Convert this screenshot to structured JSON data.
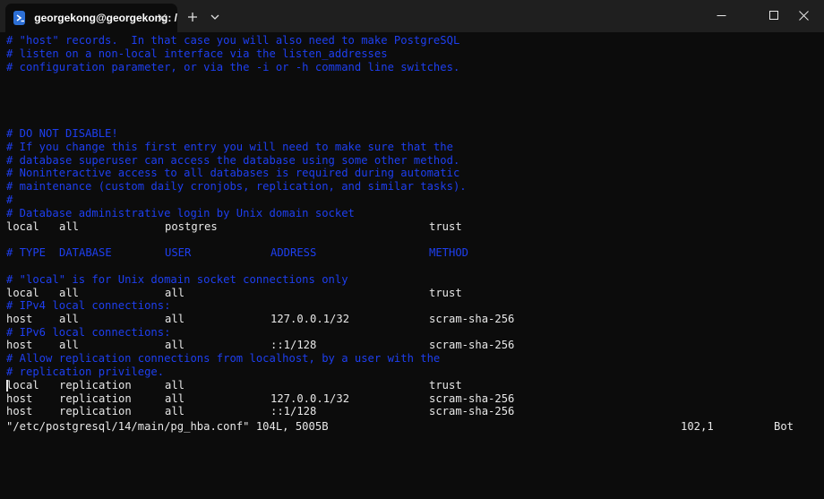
{
  "window": {
    "tab_title": "georgekong@georgekong: /",
    "tab_icon": "powershell-icon",
    "new_tab_icon": "plus-icon",
    "dropdown_icon": "chevron-down-icon",
    "minimize_icon": "minimize-icon",
    "maximize_icon": "maximize-icon",
    "close_icon": "close-icon"
  },
  "colors": {
    "background": "#0c0c0c",
    "titlebar": "#1f1f1f",
    "comment": "#1e3ff0",
    "text": "#e8e8e8"
  },
  "comments": {
    "c1": "# \"host\" records.  In that case you will also need to make PostgreSQL",
    "c2": "# listen on a non-local interface via the listen_addresses",
    "c3": "# configuration parameter, or via the -i or -h command line switches.",
    "c4": "# DO NOT DISABLE!",
    "c5": "# If you change this first entry you will need to make sure that the",
    "c6": "# database superuser can access the database using some other method.",
    "c7": "# Noninteractive access to all databases is required during automatic",
    "c8": "# maintenance (custom daily cronjobs, replication, and similar tasks).",
    "c9": "#",
    "c10": "# Database administrative login by Unix domain socket",
    "c11": "# \"local\" is for Unix domain socket connections only",
    "c12": "# IPv4 local connections:",
    "c13": "# IPv6 local connections:",
    "c14": "# Allow replication connections from localhost, by a user with the",
    "c15": "# replication privilege."
  },
  "header_row": {
    "type": "# TYPE",
    "database": "DATABASE",
    "user": "USER",
    "address": "ADDRESS",
    "method": "METHOD"
  },
  "rows": [
    {
      "type": "local",
      "database": "all",
      "user": "postgres",
      "address": "",
      "method": "trust"
    },
    {
      "type": "local",
      "database": "all",
      "user": "all",
      "address": "",
      "method": "trust"
    },
    {
      "type": "host",
      "database": "all",
      "user": "all",
      "address": "127.0.0.1/32",
      "method": "scram-sha-256"
    },
    {
      "type": "host",
      "database": "all",
      "user": "all",
      "address": "::1/128",
      "method": "scram-sha-256"
    },
    {
      "type": "local",
      "database": "replication",
      "user": "all",
      "address": "",
      "method": "trust"
    },
    {
      "type": "host",
      "database": "replication",
      "user": "all",
      "address": "127.0.0.1/32",
      "method": "scram-sha-256"
    },
    {
      "type": "host",
      "database": "replication",
      "user": "all",
      "address": "::1/128",
      "method": "scram-sha-256"
    }
  ],
  "status": {
    "file": "\"/etc/postgresql/14/main/pg_hba.conf\" 104L, 5005B",
    "position": "102,1",
    "scroll": "Bot"
  }
}
